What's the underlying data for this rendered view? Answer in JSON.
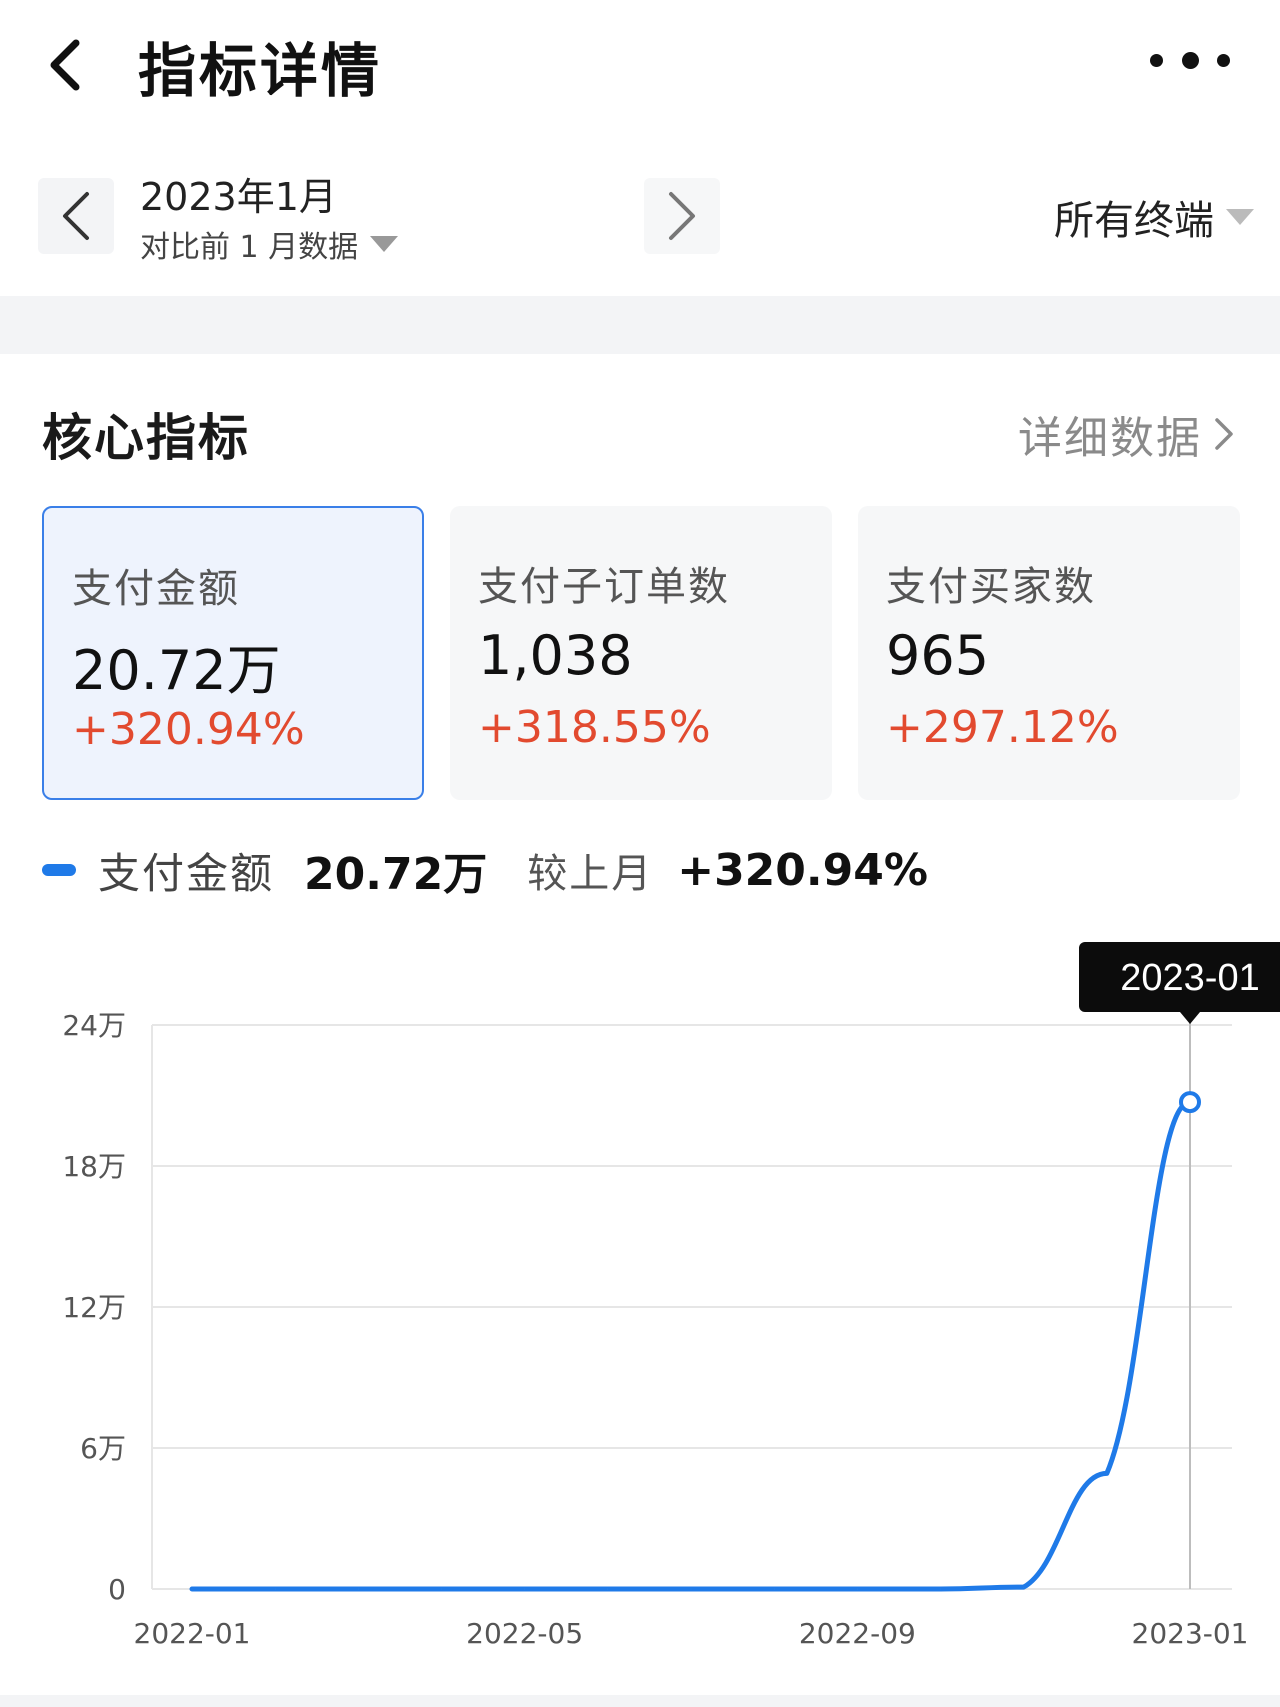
{
  "navbar": {
    "title": "指标详情",
    "back_icon": "chevron-left-icon",
    "more_icon": "more-dots-icon"
  },
  "date_selector": {
    "month": "2023年1月",
    "compare": "对比前 1 月数据",
    "terminal": "所有终端"
  },
  "core": {
    "title": "核心指标",
    "detail_link": "详细数据",
    "cards": [
      {
        "label": "支付金额",
        "value": "20.72万",
        "change": "+320.94%"
      },
      {
        "label": "支付子订单数",
        "value": "1,038",
        "change": "+318.55%"
      },
      {
        "label": "支付买家数",
        "value": "965",
        "change": "+297.12%"
      }
    ]
  },
  "legend": {
    "name": "支付金额",
    "value": "20.72万",
    "compare_label": "较上月",
    "change": "+320.94%"
  },
  "colors": {
    "accent": "#1f7ae8",
    "increase": "#e24a2f",
    "active_card_bg": "#eef3fd",
    "active_card_border": "#3a7fe8"
  },
  "chart_data": {
    "type": "line",
    "x": [
      "2022-01",
      "2022-02",
      "2022-03",
      "2022-04",
      "2022-05",
      "2022-06",
      "2022-07",
      "2022-08",
      "2022-09",
      "2022-10",
      "2022-11",
      "2022-12",
      "2023-01"
    ],
    "series": [
      {
        "name": "支付金额",
        "values": [
          0,
          0,
          0,
          0,
          0,
          0,
          0,
          0,
          0,
          0,
          800,
          49200,
          207200
        ]
      }
    ],
    "x_tick_labels": [
      "2022-01",
      "2022-05",
      "2022-09",
      "2023-01"
    ],
    "y_tick_labels": [
      "0",
      "6万",
      "12万",
      "18万",
      "24万"
    ],
    "y_ticks": [
      0,
      60000,
      120000,
      180000,
      240000
    ],
    "ylim": [
      0,
      240000
    ],
    "grid": true,
    "tooltip": {
      "label": "2023-01",
      "x": "2023-01"
    }
  }
}
